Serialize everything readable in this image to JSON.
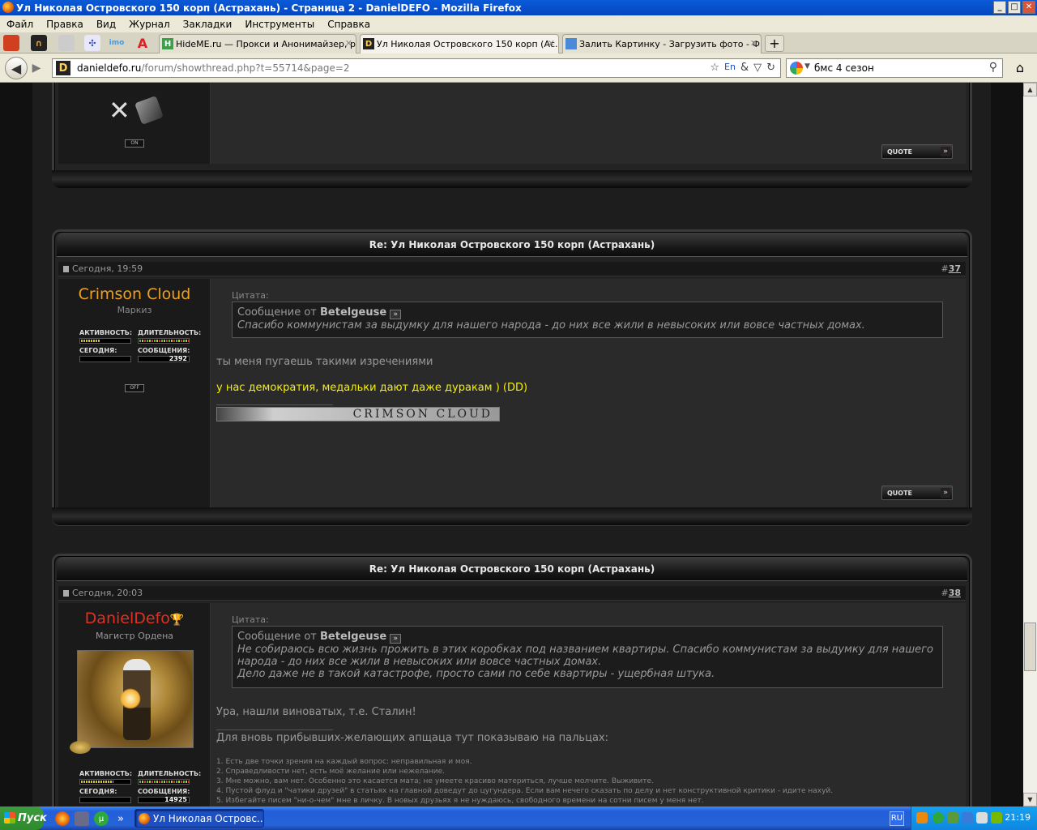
{
  "window": {
    "title": "Ул Николая Островского 150 корп (Астрахань) - Страница 2 - DanielDEFO - Mozilla Firefox",
    "minimize": "_",
    "maximize": "□",
    "close": "✕"
  },
  "menu": [
    "Файл",
    "Правка",
    "Вид",
    "Журнал",
    "Закладки",
    "Инструменты",
    "Справка"
  ],
  "tabs": [
    {
      "label": "HideME.ru — Прокси и Анонимайзер, ра...",
      "icon": "H",
      "color": "#3aa04a"
    },
    {
      "label": "Ул Николая Островского 150 корп (Ас...",
      "icon": "D",
      "color": "#222222"
    },
    {
      "label": "Залить Картинку - Загрузить фото - Ф...",
      "icon": "img",
      "color": "#4a8ad8"
    }
  ],
  "tab_close": "✕",
  "new_tab": "+",
  "url": {
    "host": "danieldefo.ru",
    "path": "/forum/showthread.php?t=55714&page=2",
    "site_icon": "D"
  },
  "search": {
    "value": "бмс 4 сезон"
  },
  "colors": {
    "accent_orange": "#f0a020",
    "accent_red": "#e03020",
    "yellow_text": "#f4f000"
  },
  "post_top": {
    "onoff": "ON",
    "quote": "QUOTE"
  },
  "post37": {
    "title": "Re: Ул Николая Островского 150 корп (Астрахань)",
    "date": "Сегодня, 19:59",
    "num_prefix": "#",
    "num": "37",
    "user": "Crimson Cloud",
    "rank": "Маркиз",
    "stats": {
      "activity": "АКТИВНОСТЬ:",
      "duration": "ДЛИТЕЛЬНОСТЬ:",
      "today": "СЕГОДНЯ:",
      "posts": "СООБЩЕНИЯ:",
      "posts_count": "2392"
    },
    "onoff": "OFF",
    "quote_label": "Цитата:",
    "quote_from_prefix": "Сообщение от",
    "quote_author": "Betelgeuse",
    "quote_text": "Спасибо коммунистам за выдумку для нашего народа - до них все жили в невысоких или вовсе частных домах.",
    "text1": "ты меня пугаешь такими изречениями",
    "text2": "у нас демократия, медальки дают даже дуракам ) (DD)",
    "signature": "CRIMSON CLOUD",
    "quote": "QUOTE"
  },
  "post38": {
    "title": "Re: Ул Николая Островского 150 корп (Астрахань)",
    "date": "Сегодня, 20:03",
    "num_prefix": "#",
    "num": "38",
    "user": "DanielDefo",
    "rank": "Магистр Ордена",
    "stats": {
      "activity": "АКТИВНОСТЬ:",
      "duration": "ДЛИТЕЛЬНОСТЬ:",
      "today": "СЕГОДНЯ:",
      "posts": "СООБЩЕНИЯ:",
      "posts_count": "14925"
    },
    "quote_label": "Цитата:",
    "quote_from_prefix": "Сообщение от",
    "quote_author": "Betelgeuse",
    "quote_text1": "Не собираюсь всю жизнь прожить в этих коробках под названием квартиры. Спасибо коммунистам за выдумку для нашего народа - до них все жили в невысоких или вовсе частных домах.",
    "quote_text2": "Дело даже не в такой катастрофе, просто сами по себе квартиры - ущербная штука.",
    "text1": "Ура, нашли виноватых, т.е. Сталин!",
    "sig_intro": "Для вновь прибывших-желающих апщаца тут показываю на пальцах:",
    "rules": [
      "1. Есть две точки зрения на каждый вопрос: неправильная и моя.",
      "2. Справедливости нет, есть моё желание или нежелание.",
      "3. Мне можно, вам нет. Особенно это касается мата; не умеете красиво материться, лучше молчите. Выживите.",
      "4. Пустой флуд и \"чатики друзей\" в статьях на главной доведут до цугундера. Если вам нечего сказать по делу и нет конструктивной критики - идите нахуй.",
      "5. Избегайте писем \"ни-о-чем\" мне в личку. В новых друзьях я не нуждаюсь, свободного времени на сотни писем у меня нет."
    ]
  },
  "taskbar": {
    "start": "Пуск",
    "task": "Ул Николая Островс...",
    "more": "»",
    "lang": "RU",
    "clock": "21:19"
  }
}
